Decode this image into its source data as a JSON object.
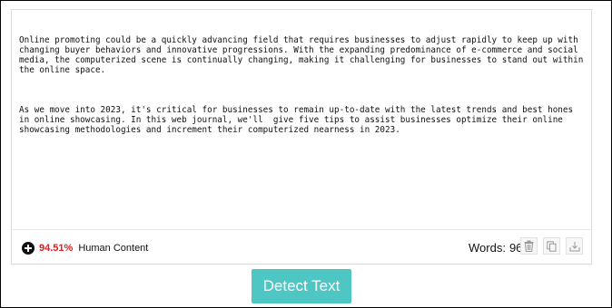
{
  "editor": {
    "paragraphs": [
      "Online promoting could be a quickly advancing field that requires businesses to adjust rapidly to keep up with changing buyer behaviors and innovative progressions. With the expanding predominance of e-commerce and social media, the computerized scene is continually changing, making it challenging for businesses to stand out within the online space.",
      "As we move into 2023, it's critical for businesses to remain up-to-date with the latest trends and best hones in online showcasing. In this web journal, we'll  give five tips to assist businesses optimize their online showcasing methodologies and increment their computerized nearness in 2023."
    ]
  },
  "result": {
    "score": "94.51%",
    "label": "Human Content",
    "score_color": "#e21b1b"
  },
  "stats": {
    "words_label": "Words:",
    "words_count": "96"
  },
  "actions": {
    "trash_icon": "trash-icon",
    "copy_icon": "copy-icon",
    "download_icon": "download-icon"
  },
  "detect_button": {
    "label": "Detect Text",
    "color": "#4ec6c4"
  }
}
